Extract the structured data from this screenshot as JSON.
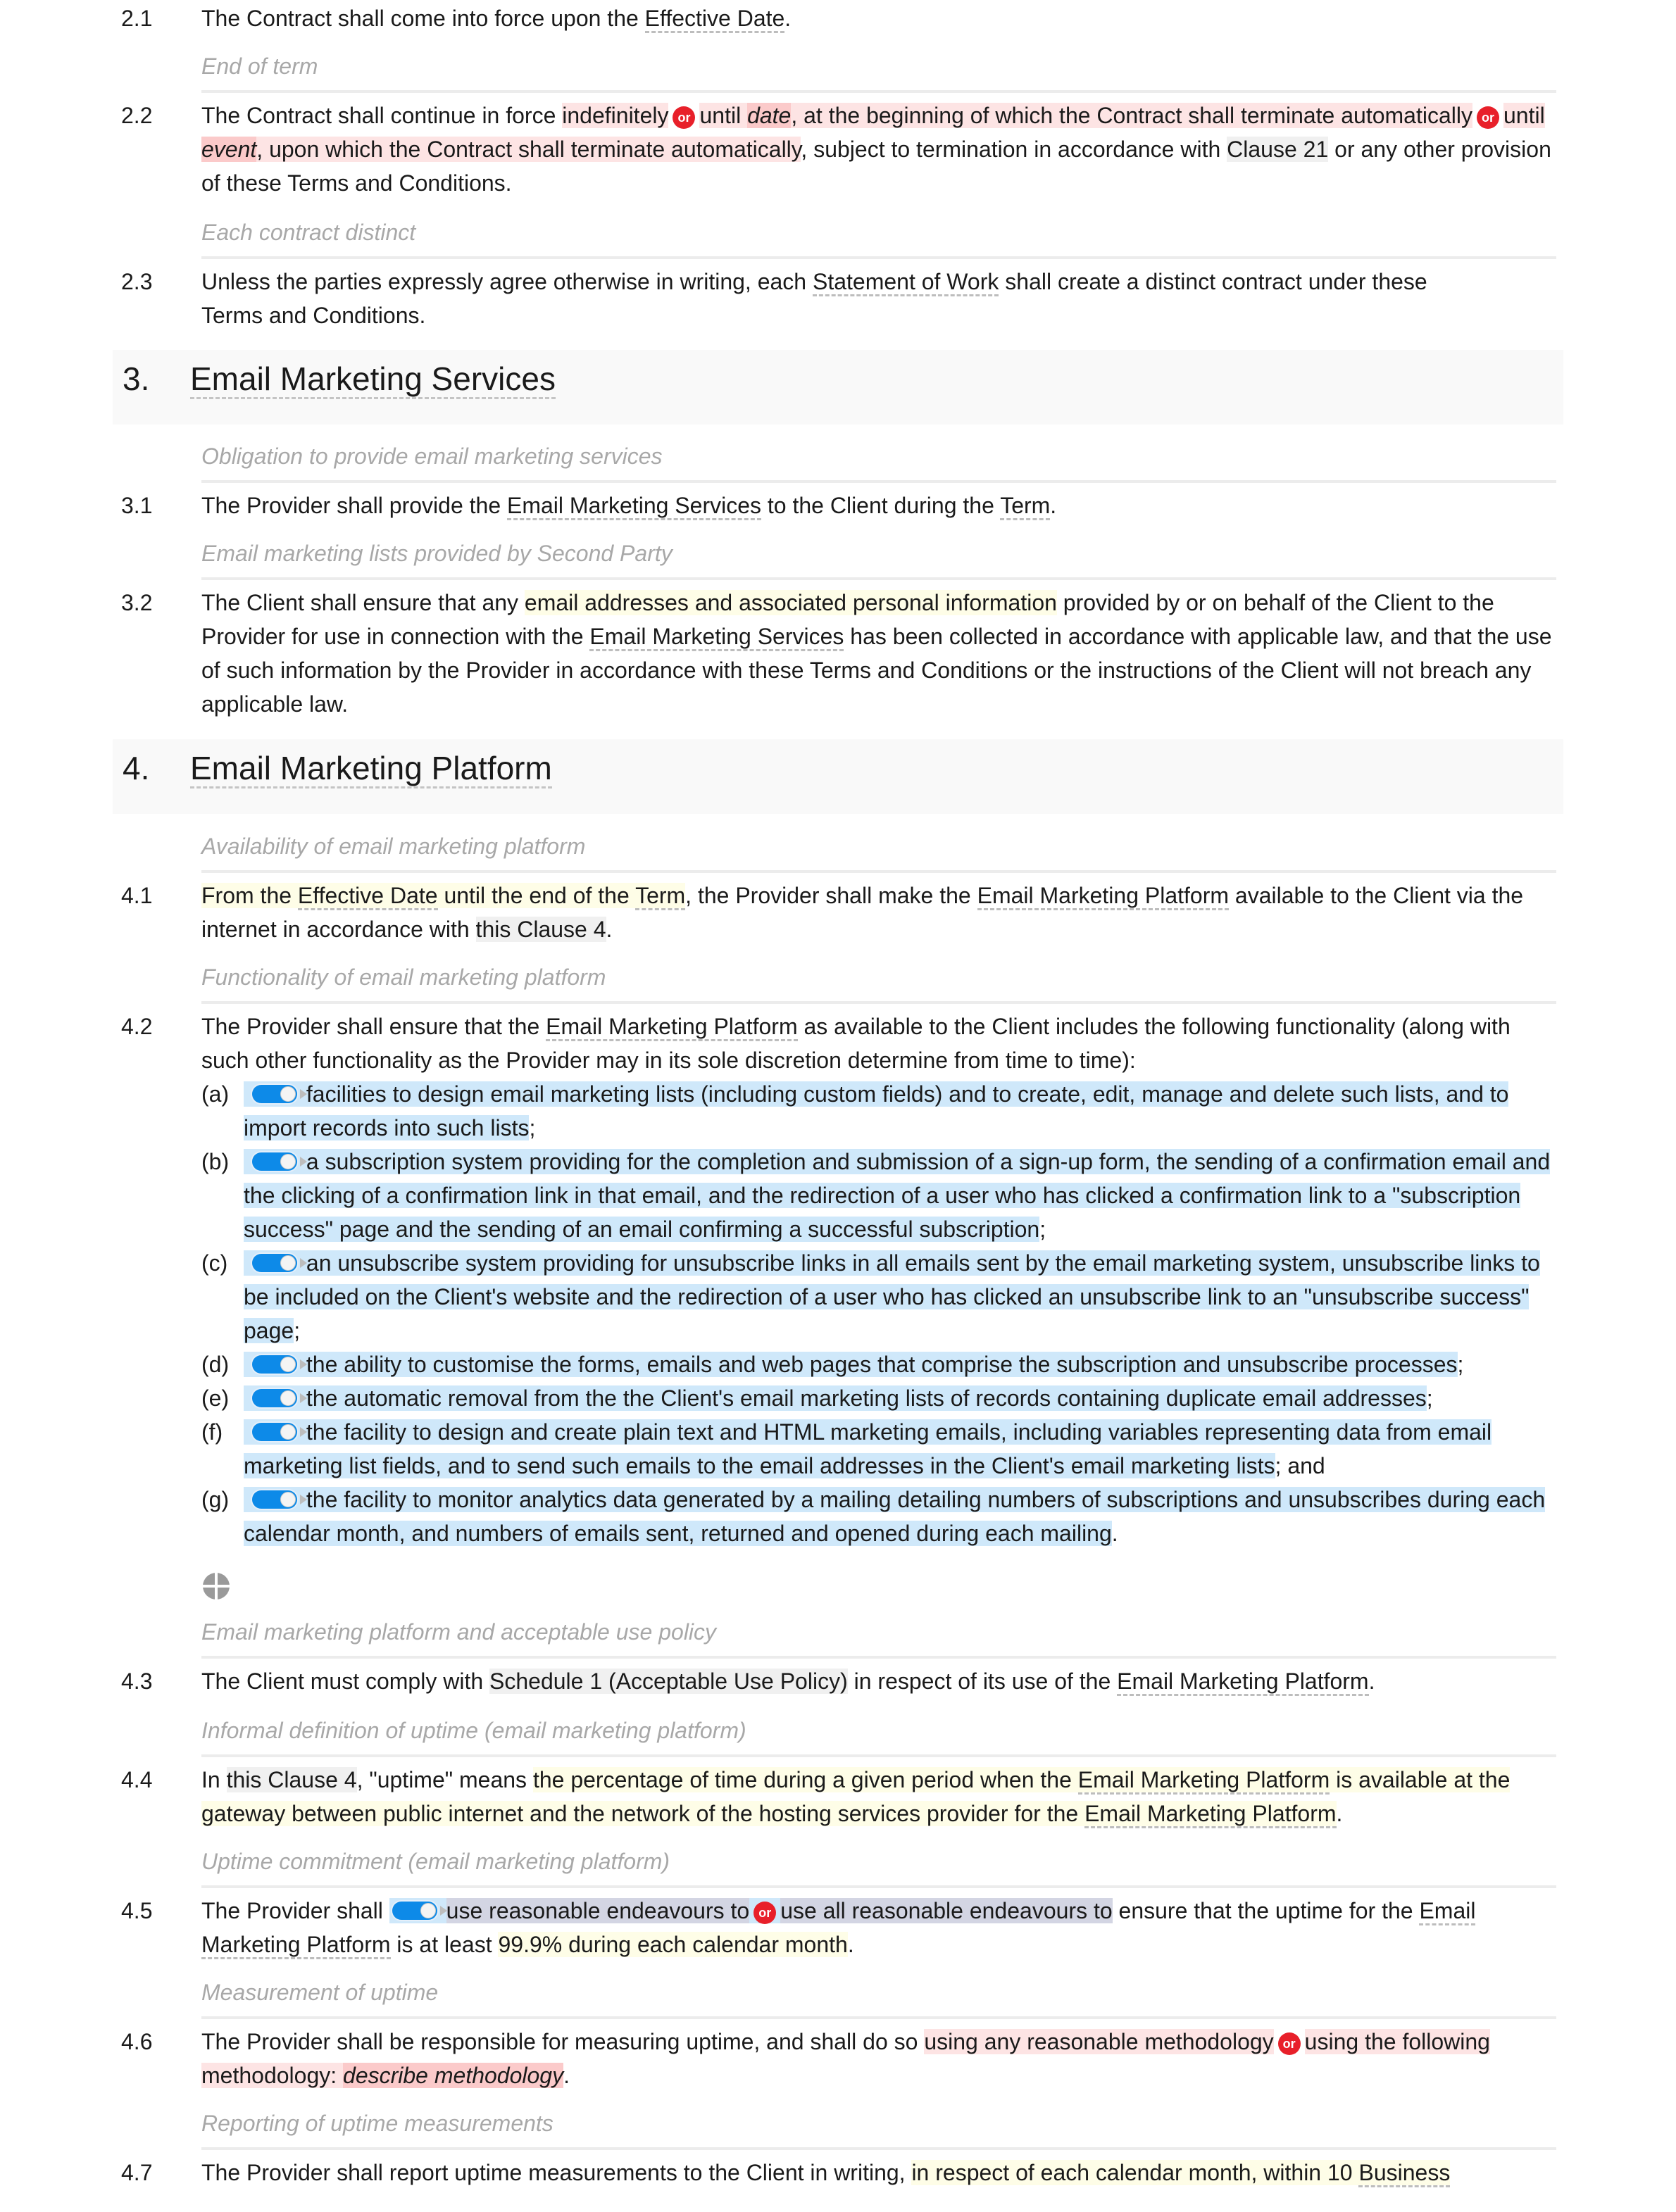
{
  "clauses_2": {
    "c2_1": {
      "num": "2.1",
      "t1": "The Contract shall come into force upon the ",
      "def1": "Effective Date",
      "t2": "."
    },
    "cap_2_2": "End of term",
    "c2_2": {
      "num": "2.2",
      "t1": "The Contract shall continue in force ",
      "opt1": "indefinitely",
      "or": "or",
      "opt2a": "until ",
      "opt2var": "date",
      "opt2b": ", at the beginning of which the Contract shall terminate automatically",
      "opt3a": "until ",
      "opt3var": "event",
      "opt3b": ", upon which the Contract shall terminate automatically",
      "t2": ", subject to termination in accordance with ",
      "ref": "Clause 21",
      "t3": " or any other provision of these Terms and Conditions."
    },
    "cap_2_3": "Each contract distinct",
    "c2_3": {
      "num": "2.3",
      "t1": "Unless the parties expressly agree otherwise in writing, each ",
      "def1": "Statement of Work",
      "t2": " shall create a distinct contract under these Terms and Conditions."
    }
  },
  "section3": {
    "num": "3.",
    "title": "Email Marketing Services",
    "cap_3_1": "Obligation to provide email marketing services",
    "c3_1": {
      "num": "3.1",
      "t1": "The Provider shall provide the ",
      "def1": "Email Marketing Services",
      "t2": " to the Client during the ",
      "def2": "Term",
      "t3": "."
    },
    "cap_3_2": "Email marketing lists provided by Second Party",
    "c3_2": {
      "num": "3.2",
      "t1": "The Client shall ensure that any ",
      "hl1": "email addresses and associated personal information",
      "t2": " provided by or on behalf of the Client to the Provider for use in connection with the ",
      "def1": "Email Marketing Services",
      "t3": " has been collected in accordance with applicable law, and that the use of such information by the Provider in accordance with these Terms and Conditions or the instructions of the Client will not breach any applicable law."
    }
  },
  "section4": {
    "num": "4.",
    "title": "Email Marketing Platform",
    "cap_4_1": "Availability of email marketing platform",
    "c4_1": {
      "num": "4.1",
      "hl_a": "From the ",
      "def1": "Effective Date",
      "hl_b": " until the end of the ",
      "def2": "Term",
      "t1": ", the Provider shall make the ",
      "def3": "Email Marketing Platform",
      "t2": " available to the Client via the internet in accordance with ",
      "ref": "this Clause 4",
      "t3": "."
    },
    "cap_4_2": "Functionality of email marketing platform",
    "c4_2": {
      "num": "4.2",
      "t1": "The Provider shall ensure that the ",
      "def1": "Email Marketing Platform",
      "t2": " as available to the Client includes the following functionality (along with such other functionality as the Provider may in its sole discretion determine from time to time):",
      "items": [
        {
          "label": "(a)",
          "text": "facilities to design email marketing lists (including custom fields) and to create, edit, manage and delete such lists, and to import records into such lists",
          "end": ";",
          "enabled": true
        },
        {
          "label": "(b)",
          "text": "a subscription system providing for the completion and submission of a sign-up form, the sending of a confirmation email and the clicking of a confirmation link in that email, and the redirection of a user who has clicked a confirmation link to a \"subscription success\" page and the sending of an email confirming a successful subscription",
          "end": ";",
          "enabled": true
        },
        {
          "label": "(c)",
          "text": "an unsubscribe system providing for unsubscribe links in all emails sent by the email marketing system, unsubscribe links to be included on the Client's website and the redirection of a user who has clicked an unsubscribe link to an \"unsubscribe success\" page",
          "end": ";",
          "enabled": true
        },
        {
          "label": "(d)",
          "text": "the ability to customise the forms, emails and web pages that comprise the subscription and unsubscribe processes",
          "end": ";",
          "enabled": true
        },
        {
          "label": "(e)",
          "text": "the automatic removal from the the Client's email marketing lists of records containing duplicate email addresses",
          "end": ";",
          "enabled": true
        },
        {
          "label": "(f)",
          "text": "the facility to design and create plain text and HTML marketing emails, including variables representing data from email marketing list fields, and to send such emails to the email addresses in the Client's email marketing lists",
          "end": "; and",
          "enabled": true
        },
        {
          "label": "(g)",
          "text": "the facility to monitor analytics data generated by a mailing detailing numbers of subscriptions and unsubscribes during each calendar month, and numbers of emails sent, returned and opened during each mailing",
          "end": ".",
          "enabled": true
        }
      ]
    },
    "cap_4_3": "Email marketing platform and acceptable use policy",
    "c4_3": {
      "num": "4.3",
      "t1": "The Client must comply with ",
      "ref": "Schedule 1 (Acceptable Use Policy)",
      "t2": " in respect of its use of the ",
      "def1": "Email Marketing Platform",
      "t3": "."
    },
    "cap_4_4": "Informal definition of uptime (email marketing platform)",
    "c4_4": {
      "num": "4.4",
      "t0": "In ",
      "ref": "this Clause 4",
      "t1": ", \"uptime\" means ",
      "hl_a": "the percentage of time during a given period when the ",
      "def1": "Email Marketing Platform",
      "hl_b": " is available at the gateway between public internet and the network of the hosting services provider for the ",
      "def2": "Email Marketing Platform",
      "t2": "."
    },
    "cap_4_5": "Uptime commitment (email marketing platform)",
    "c4_5": {
      "num": "4.5",
      "t1": "The Provider shall ",
      "opt1": "use reasonable endeavours to",
      "or": "or",
      "opt2": "use all reasonable endeavours to",
      "t2": " ensure that the uptime for the ",
      "def1": "Email Marketing Platform",
      "t3": " is at least ",
      "hl1": "99.9% during each calendar month",
      "t4": "."
    },
    "cap_4_6": "Measurement of uptime",
    "c4_6": {
      "num": "4.6",
      "t1": "The Provider shall be responsible for measuring uptime, and shall do so ",
      "opt1": "using any reasonable methodology",
      "or": "or",
      "opt2a": "using the following methodology: ",
      "opt2var": "describe methodology",
      "t2": "."
    },
    "cap_4_7": "Reporting of uptime measurements",
    "c4_7": {
      "num": "4.7",
      "t1": "The Provider shall report uptime measurements to the Client in writing, ",
      "hl1": "in respect of each calendar month, within 10 ",
      "def1": "Business"
    }
  }
}
